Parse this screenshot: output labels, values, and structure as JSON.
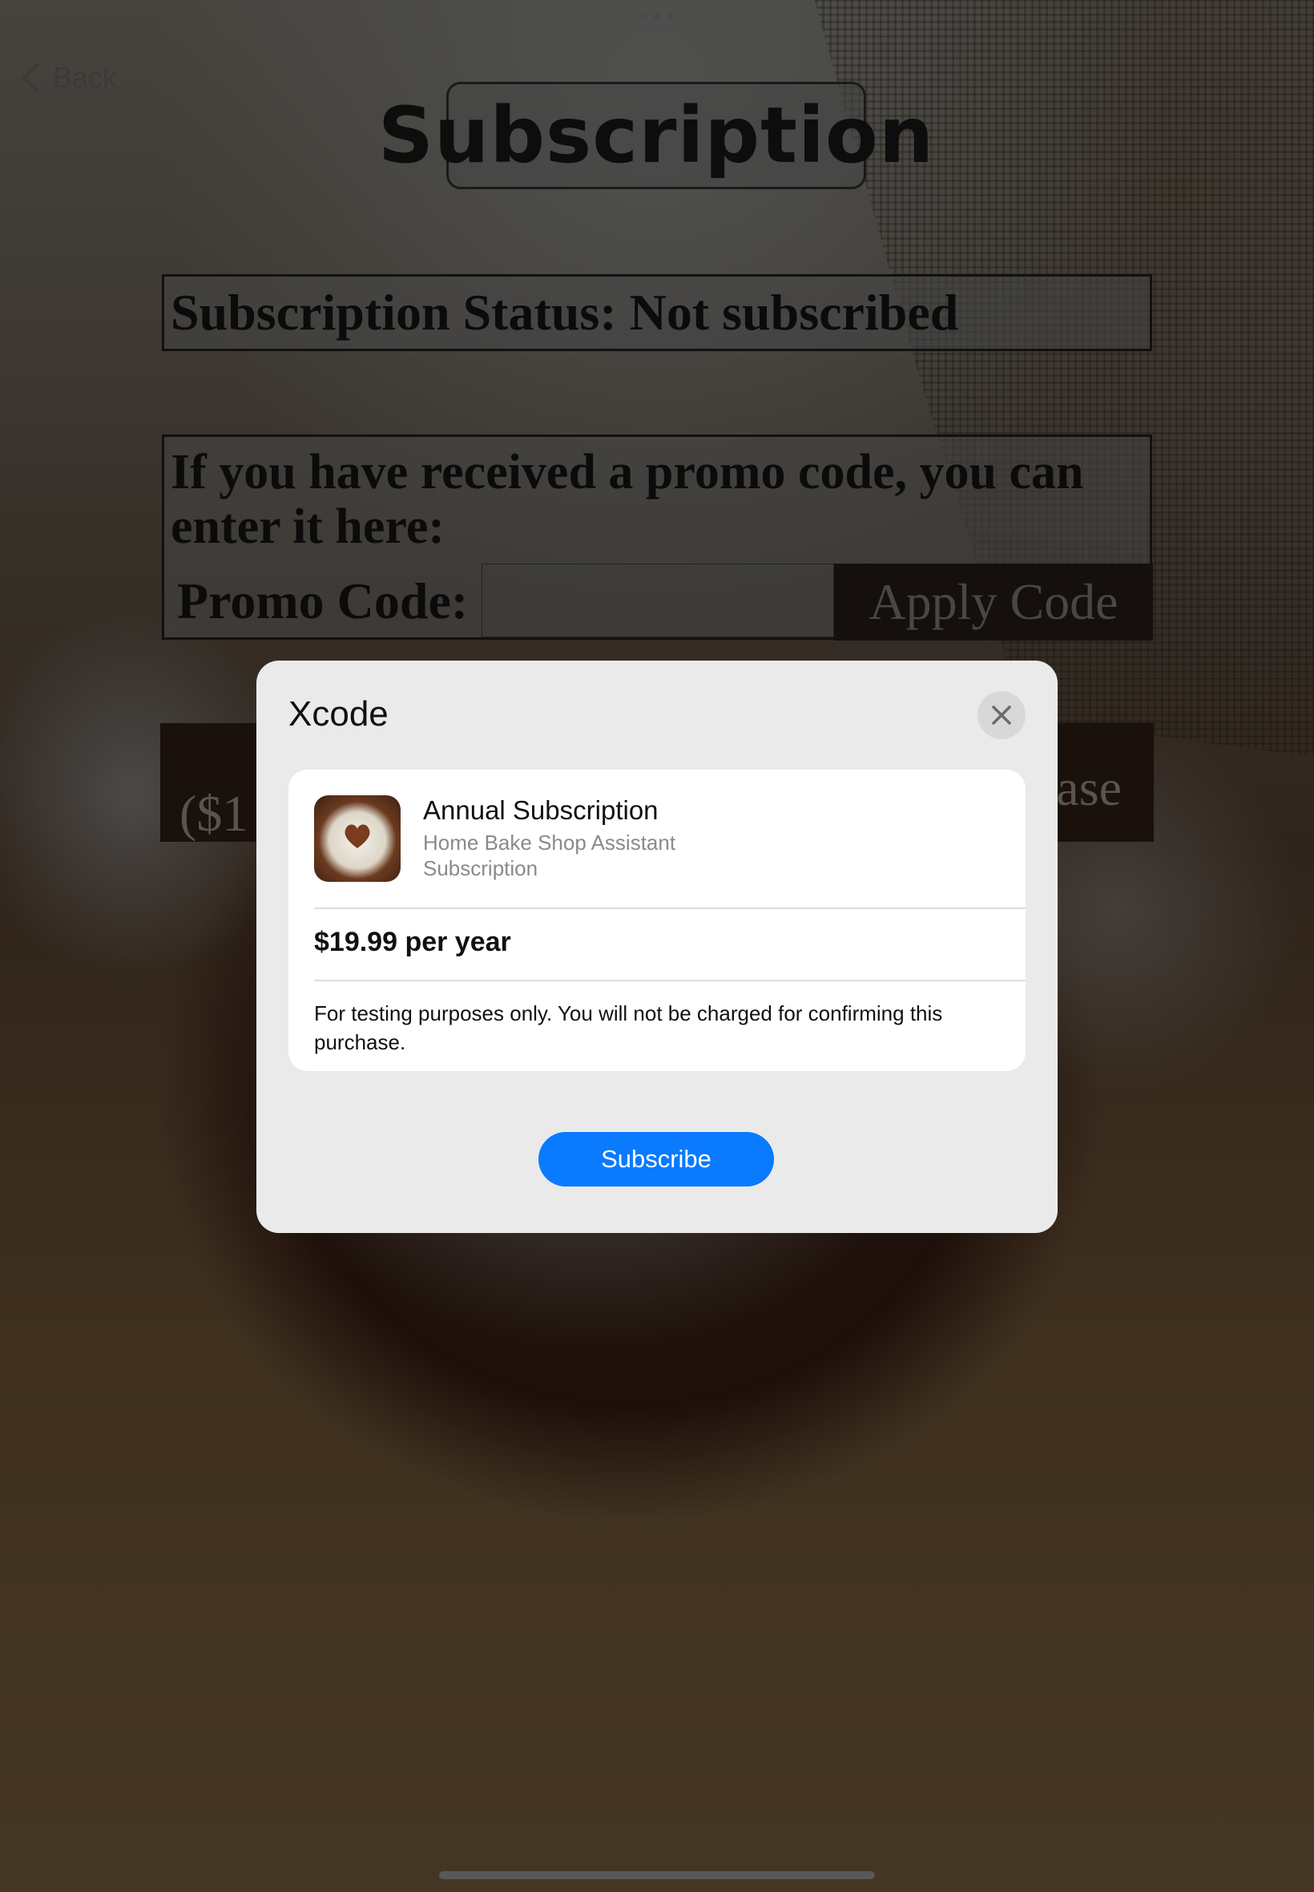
{
  "screen": {
    "back_label": "Back",
    "title": "Subscription",
    "status_text": "Subscription Status: Not subscribed",
    "promo": {
      "prompt": "If you have received a promo code, you can enter it here:",
      "label": "Promo Code:",
      "input_value": "",
      "apply_label": "Apply Code"
    },
    "purchase_button": {
      "left_fragment": "($1",
      "right_fragment": "ase"
    }
  },
  "modal": {
    "title": "Xcode",
    "close_icon": "close-icon",
    "product": {
      "name": "Annual Subscription",
      "app_name": "Home Bake Shop Assistant",
      "kind": "Subscription"
    },
    "price": "$19.99 per year",
    "disclaimer": "For testing purposes only. You will not be charged for confirming this purchase.",
    "subscribe_label": "Subscribe"
  },
  "colors": {
    "accent": "#0a7aff",
    "modal_bg": "#ebeaea",
    "card_bg": "#ffffff"
  }
}
